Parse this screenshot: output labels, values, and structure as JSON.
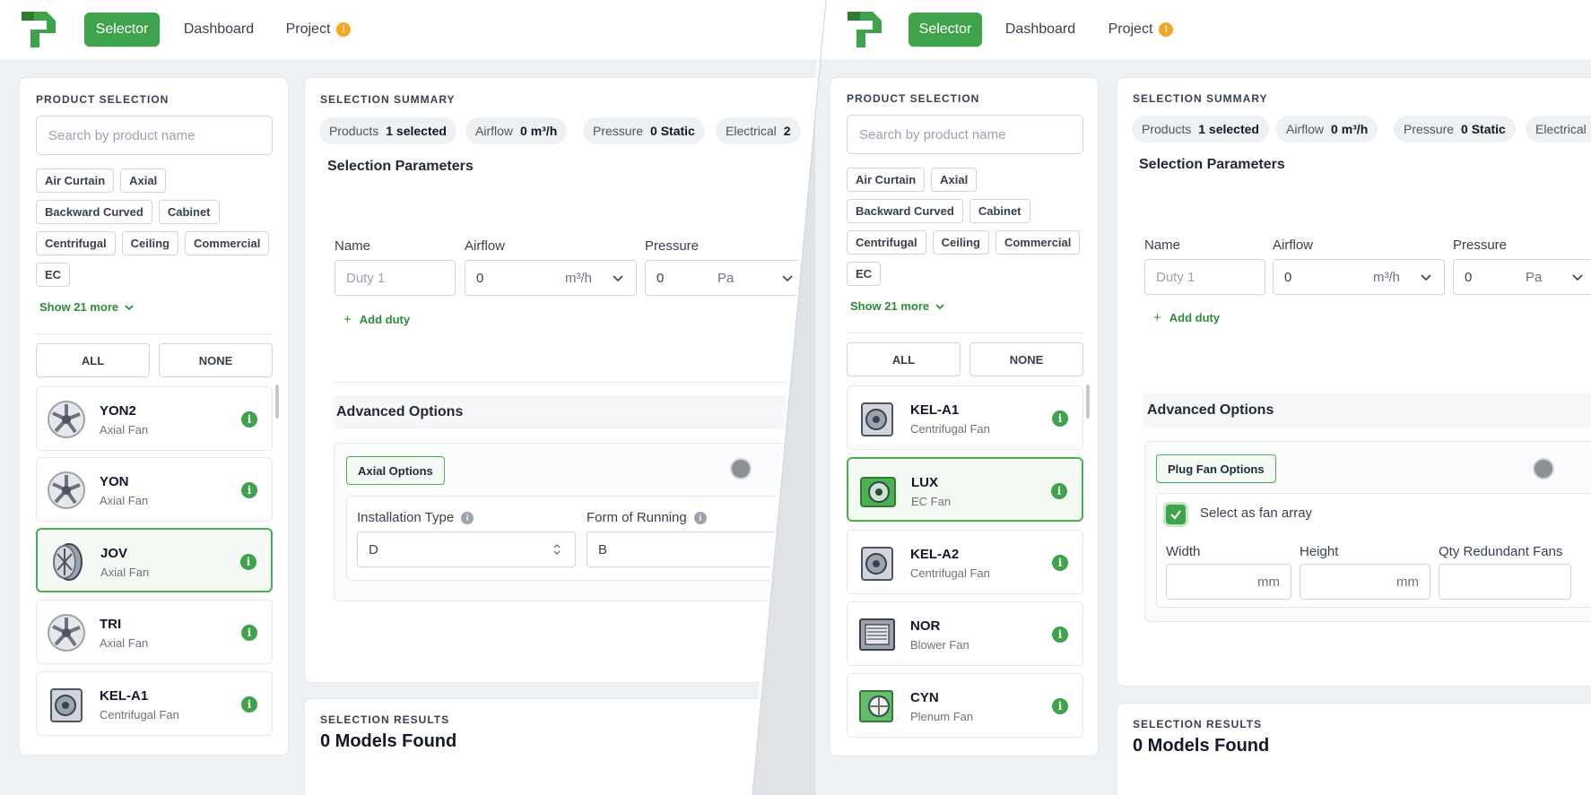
{
  "nav": {
    "selector": "Selector",
    "dashboard": "Dashboard",
    "project": "Project",
    "project_badge": "!"
  },
  "product_selection": {
    "title": "PRODUCT SELECTION",
    "search_placeholder": "Search by product name",
    "chips": [
      "Air Curtain",
      "Axial",
      "Backward Curved",
      "Cabinet",
      "Centrifugal",
      "Ceiling",
      "Commercial",
      "EC"
    ],
    "show_more": "Show 21 more",
    "all": "ALL",
    "none": "NONE"
  },
  "left_products": [
    {
      "name": "YON2",
      "type": "Axial Fan",
      "icon": "axial-fan-icon"
    },
    {
      "name": "YON",
      "type": "Axial Fan",
      "icon": "axial-fan-icon"
    },
    {
      "name": "JOV",
      "type": "Axial Fan",
      "icon": "axial-fan-icon",
      "selected": true
    },
    {
      "name": "TRI",
      "type": "Axial Fan",
      "icon": "axial-fan-icon"
    },
    {
      "name": "KEL-A1",
      "type": "Centrifugal Fan",
      "icon": "centrifugal-fan-icon"
    }
  ],
  "right_products": [
    {
      "name": "KEL-A1",
      "type": "Centrifugal Fan",
      "icon": "centrifugal-fan-icon"
    },
    {
      "name": "LUX",
      "type": "EC Fan",
      "icon": "ec-fan-icon",
      "selected": true
    },
    {
      "name": "KEL-A2",
      "type": "Centrifugal Fan",
      "icon": "centrifugal-fan-icon"
    },
    {
      "name": "NOR",
      "type": "Blower Fan",
      "icon": "blower-fan-icon"
    },
    {
      "name": "CYN",
      "type": "Plenum Fan",
      "icon": "plenum-fan-icon"
    }
  ],
  "info_glyph": "i",
  "summary": {
    "title": "SELECTION SUMMARY",
    "products_label": "Products",
    "products_value": "1 selected",
    "airflow_label": "Airflow",
    "airflow_value": "0 m³/h",
    "pressure_label": "Pressure",
    "pressure_value": "0 Static",
    "electrical_label": "Electrical",
    "electrical_value": "2"
  },
  "params": {
    "title": "Selection Parameters",
    "name_label": "Name",
    "name_placeholder": "Duty 1",
    "airflow_label": "Airflow",
    "airflow_value": "0",
    "airflow_unit": "m³/h",
    "pressure_label": "Pressure",
    "pressure_value": "0",
    "pressure_unit": "Pa",
    "add_duty": "Add duty"
  },
  "advanced": {
    "title": "Advanced Options",
    "axial_options": "Axial Options",
    "installation_type_label": "Installation Type",
    "installation_type_value": "D",
    "form_of_running_label": "Form of Running",
    "form_of_running_value": "B",
    "plug_fan_options": "Plug Fan Options",
    "fan_array_label": "Select as fan array",
    "width_label": "Width",
    "height_label": "Height",
    "qty_label": "Qty Redundant Fans",
    "mm": "mm"
  },
  "results": {
    "title": "SELECTION RESULTS",
    "count": "0 Models Found"
  },
  "colors": {
    "brand_green": "#3ea34a",
    "badge_orange": "#f5a623"
  }
}
